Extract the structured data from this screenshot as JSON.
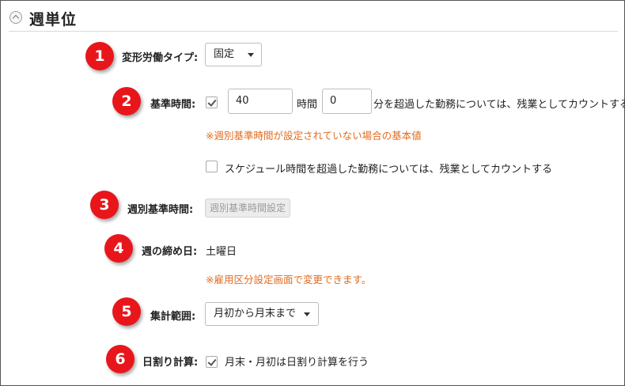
{
  "section": {
    "title": "週単位",
    "icon": "chevron-up-icon"
  },
  "badges": [
    "1",
    "2",
    "3",
    "4",
    "5",
    "6"
  ],
  "badge_color": "#e8161b",
  "note_color": "#e26a1e",
  "rows": {
    "henkei": {
      "label": "変形労働タイプ:",
      "select_value": "固定"
    },
    "kijun": {
      "label": "基準時間:",
      "checked": true,
      "hours_value": "40",
      "hours_unit": "時間",
      "minutes_value": "0",
      "trailing_text": "分を超過した勤務については、残業としてカウントする",
      "note": "※週別基準時間が設定されていない場合の基本値",
      "schedule_checked": false,
      "schedule_text": "スケジュール時間を超過した勤務については、残業としてカウントする"
    },
    "shubetsu": {
      "label": "週別基準時間:",
      "button_label": "週別基準時間設定"
    },
    "shimebi": {
      "label": "週の締め日:",
      "value": "土曜日",
      "note": "※雇用区分設定画面で変更できます。"
    },
    "shukei": {
      "label": "集計範囲:",
      "select_value": "月初から月末まで"
    },
    "hiwari": {
      "label": "日割り計算:",
      "checked": true,
      "text": "月末・月初は日割り計算を行う"
    }
  }
}
